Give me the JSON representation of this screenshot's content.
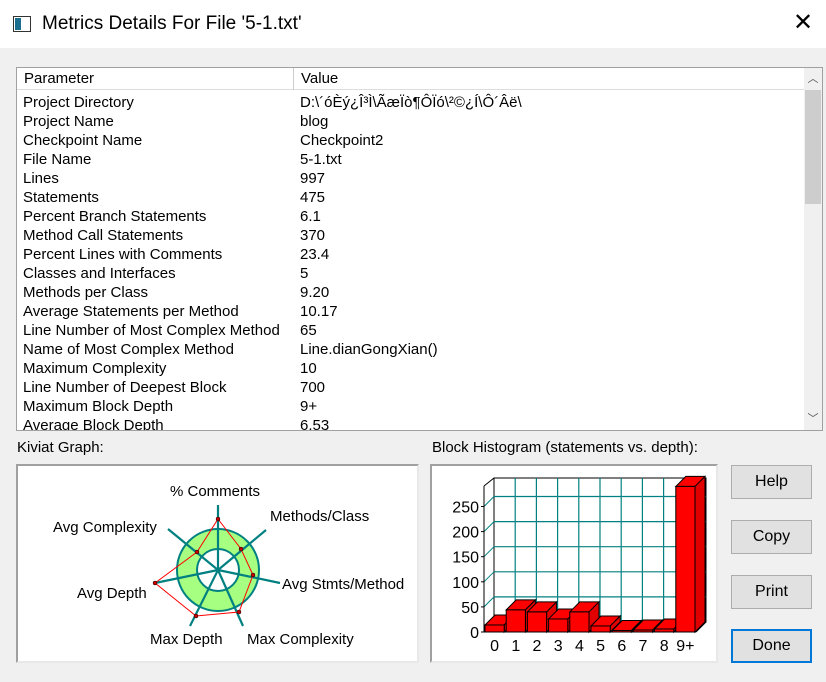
{
  "window": {
    "title": "Metrics Details For File '5-1.txt'"
  },
  "table": {
    "headers": [
      "Parameter",
      "Value"
    ],
    "rows": [
      [
        "Project Directory",
        "D:\\´óÈý¿Î³Ì\\ÃæÏò¶ÔÏó\\²©¿Í\\Ô´Âë\\"
      ],
      [
        "Project Name",
        "blog"
      ],
      [
        "Checkpoint Name",
        "Checkpoint2"
      ],
      [
        "File Name",
        "5-1.txt"
      ],
      [
        "Lines",
        "997"
      ],
      [
        "Statements",
        "475"
      ],
      [
        "Percent Branch Statements",
        "6.1"
      ],
      [
        "Method Call Statements",
        "370"
      ],
      [
        "Percent Lines with Comments",
        "23.4"
      ],
      [
        "Classes and Interfaces",
        "5"
      ],
      [
        "Methods per Class",
        "9.20"
      ],
      [
        "Average Statements per Method",
        "10.17"
      ],
      [
        "Line Number of Most Complex Method",
        "65"
      ],
      [
        "Name of Most Complex Method",
        "Line.dianGongXian()"
      ],
      [
        "Maximum Complexity",
        "10"
      ],
      [
        "Line Number of Deepest Block",
        "700"
      ],
      [
        "Maximum Block Depth",
        "9+"
      ],
      [
        "Average Block Depth",
        "6.53"
      ]
    ]
  },
  "kiviat": {
    "label": "Kiviat Graph:",
    "axes": [
      "% Comments",
      "Methods/Class",
      "Avg Stmts/Method",
      "Max Complexity",
      "Max Depth",
      "Avg Depth",
      "Avg Complexity"
    ]
  },
  "chart_data": {
    "type": "bar",
    "title": "Block Histogram (statements vs. depth):",
    "categories": [
      "0",
      "1",
      "2",
      "3",
      "4",
      "5",
      "6",
      "7",
      "8",
      "9+"
    ],
    "values": [
      14,
      44,
      40,
      26,
      40,
      12,
      3,
      4,
      6,
      290
    ],
    "yticks": [
      "0",
      "50",
      "100",
      "150",
      "200",
      "250"
    ],
    "ylim": [
      0,
      300
    ],
    "grid": true,
    "color": "#ff0000"
  },
  "buttons": {
    "help": "Help",
    "copy": "Copy",
    "print": "Print",
    "done": "Done"
  }
}
